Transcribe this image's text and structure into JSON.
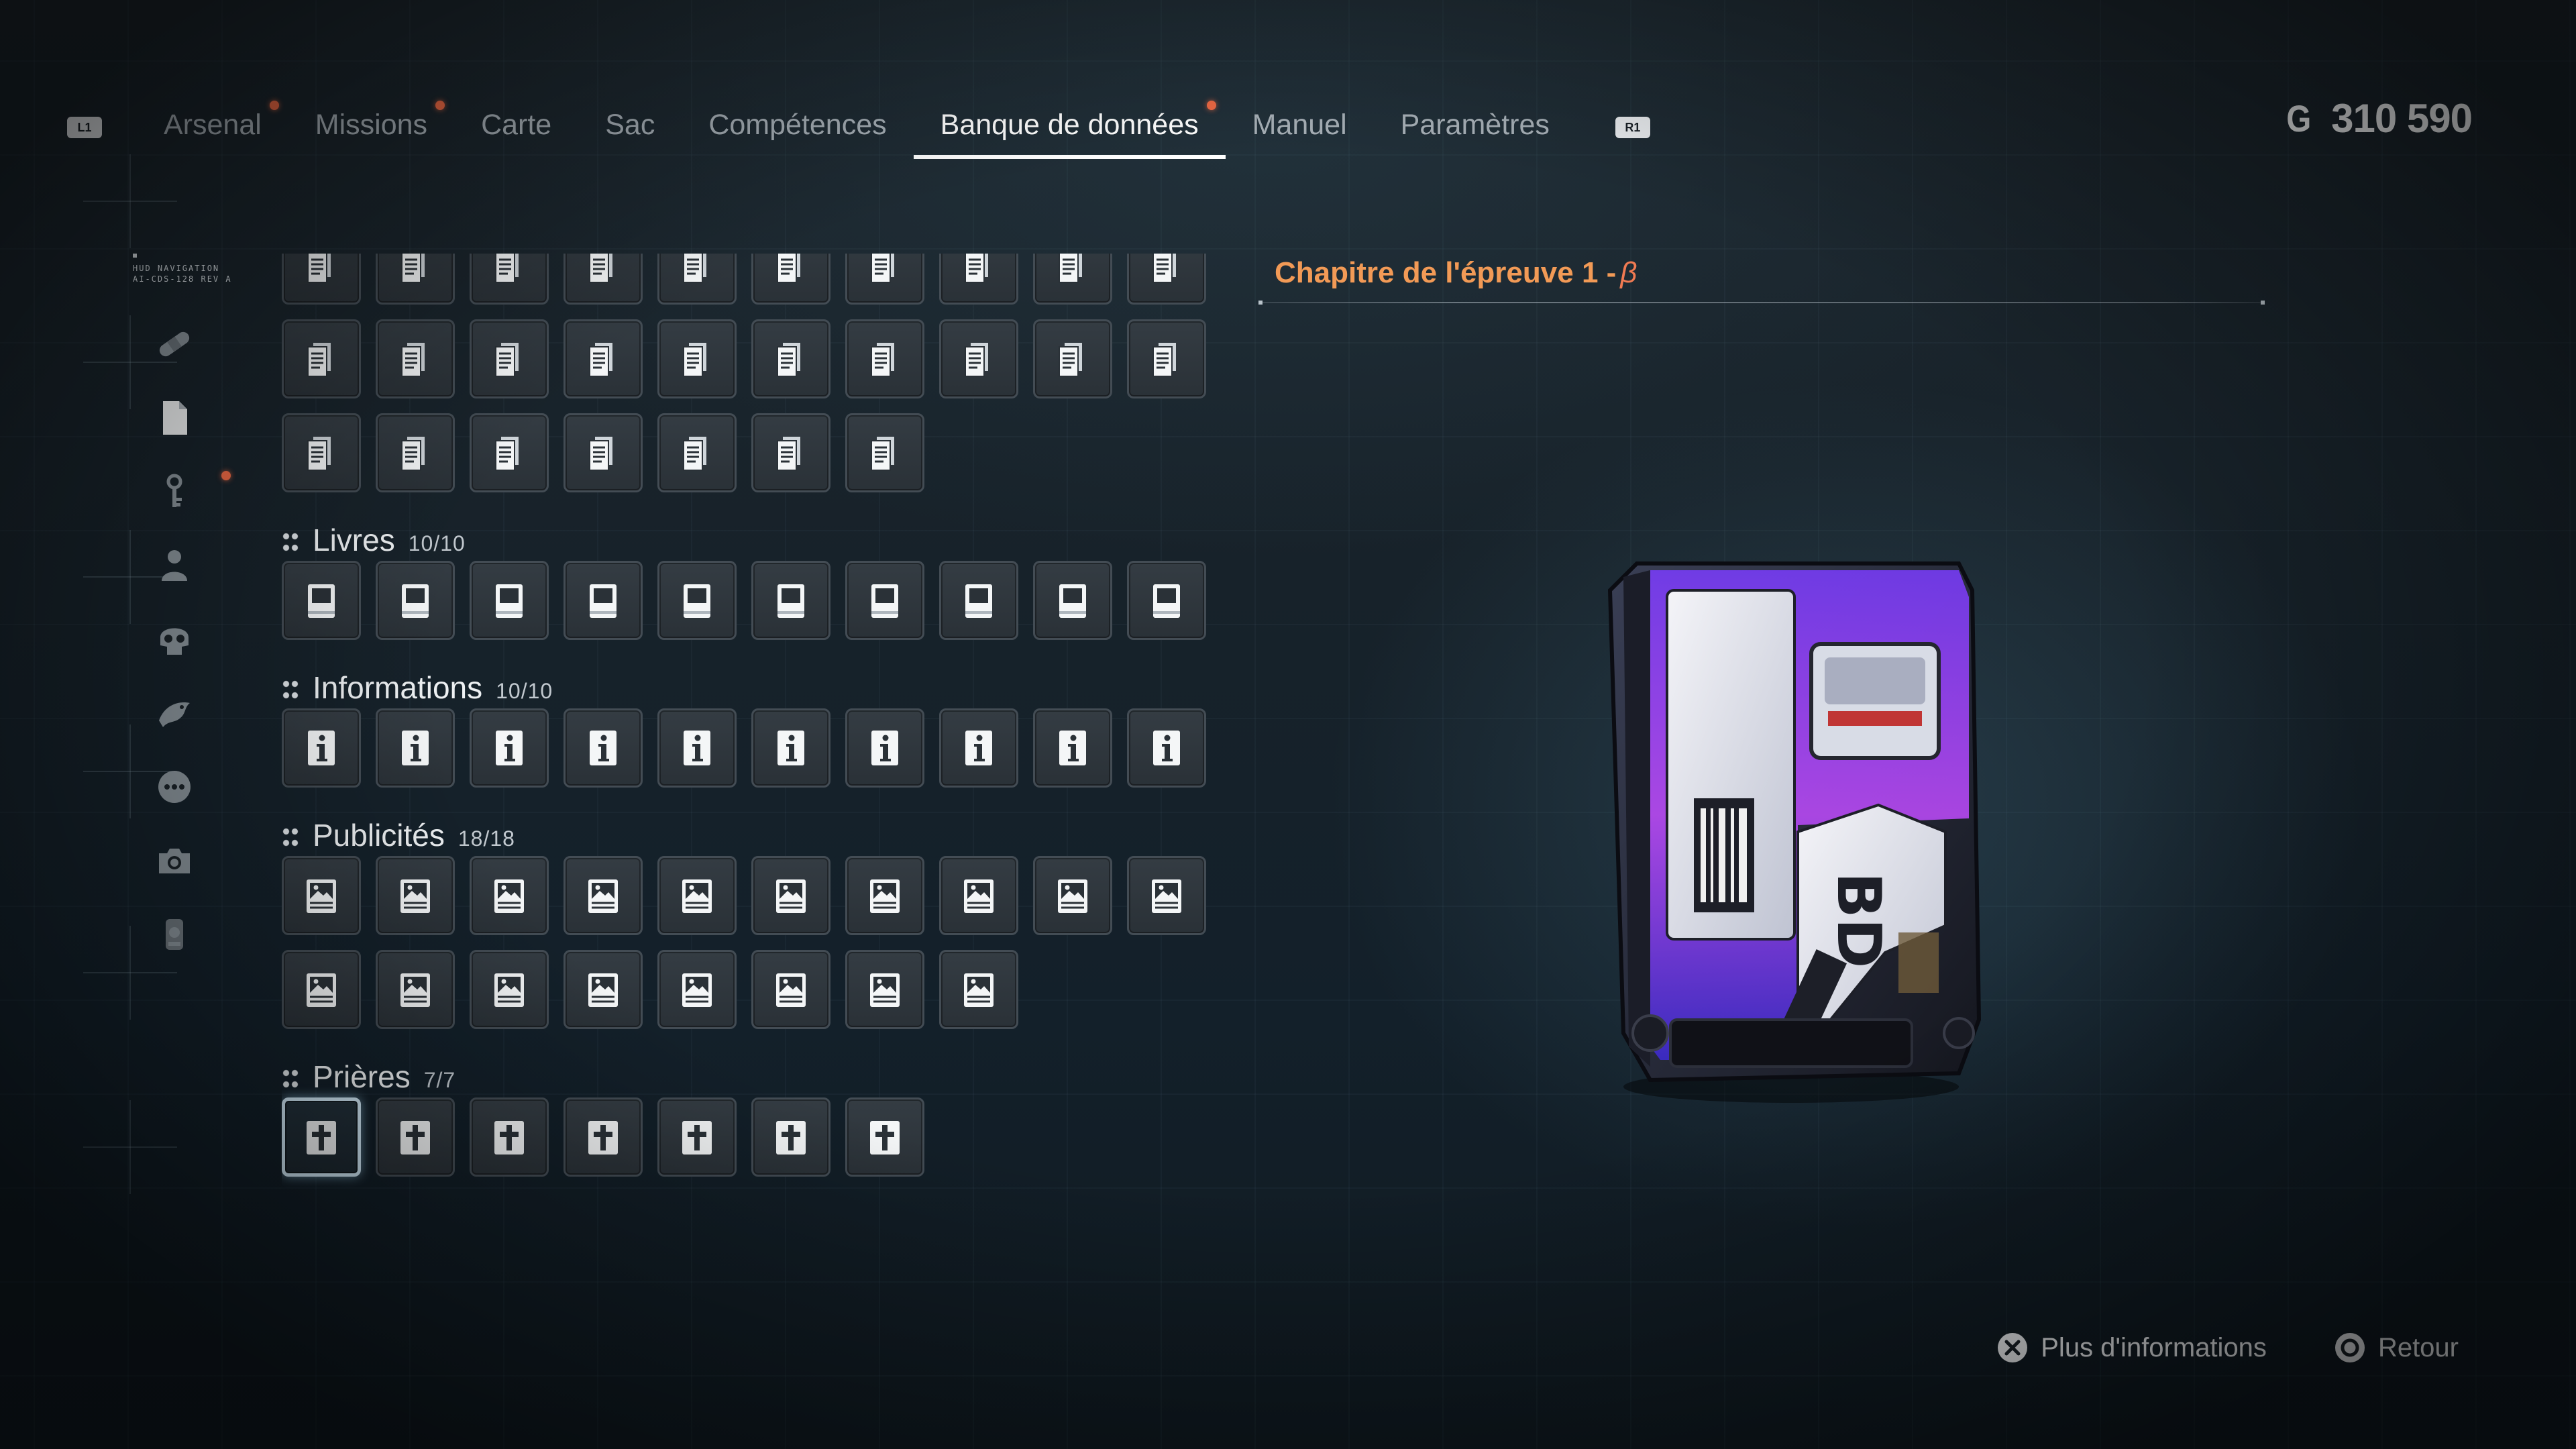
{
  "nav": {
    "left_hint": "L1",
    "right_hint": "R1",
    "tabs": [
      {
        "label": "Arsenal",
        "notify": true,
        "active": false
      },
      {
        "label": "Missions",
        "notify": true,
        "active": false
      },
      {
        "label": "Carte",
        "notify": false,
        "active": false
      },
      {
        "label": "Sac",
        "notify": false,
        "active": false
      },
      {
        "label": "Compétences",
        "notify": false,
        "active": false
      },
      {
        "label": "Banque de données",
        "notify": true,
        "active": true
      },
      {
        "label": "Manuel",
        "notify": false,
        "active": false
      },
      {
        "label": "Paramètres",
        "notify": false,
        "active": false
      }
    ]
  },
  "currency": {
    "symbol": "G",
    "amount": "310 590"
  },
  "sidebar": {
    "hud_label_line1": "HUD NAVIGATION",
    "hud_label_line2": "AI-CDS-128 REV A",
    "items": [
      {
        "icon": "bandage-icon",
        "active": false,
        "notify": false
      },
      {
        "icon": "document-icon",
        "active": true,
        "notify": false
      },
      {
        "icon": "key-icon",
        "active": false,
        "notify": true
      },
      {
        "icon": "person-icon",
        "active": false,
        "notify": false
      },
      {
        "icon": "skull-icon",
        "active": false,
        "notify": false
      },
      {
        "icon": "creature-icon",
        "active": false,
        "notify": false
      },
      {
        "icon": "chat-icon",
        "active": false,
        "notify": false
      },
      {
        "icon": "camera-icon",
        "active": false,
        "notify": false
      },
      {
        "icon": "canister-icon",
        "active": false,
        "notify": false
      }
    ]
  },
  "grid": {
    "documents_rows": [
      10,
      10,
      7
    ],
    "sections": [
      {
        "title": "Livres",
        "count": "10/10",
        "icon": "book-icon",
        "rows": [
          10
        ]
      },
      {
        "title": "Informations",
        "count": "10/10",
        "icon": "info-icon",
        "rows": [
          10
        ]
      },
      {
        "title": "Publicités",
        "count": "18/18",
        "icon": "image-icon",
        "rows": [
          10,
          8
        ]
      },
      {
        "title": "Prières",
        "count": "7/7",
        "icon": "cross-icon",
        "rows": [
          7
        ],
        "selected_index": 0
      }
    ]
  },
  "detail": {
    "title": "Chapitre de l'épreuve 1 -",
    "title_suffix": "β"
  },
  "prompts": {
    "confirm_label": "Plus d'informations",
    "back_label": "Retour"
  },
  "colors": {
    "accent_orange": "#f29a56",
    "notify_dot": "#ef6a45",
    "selection_border": "#cfe6f4"
  }
}
